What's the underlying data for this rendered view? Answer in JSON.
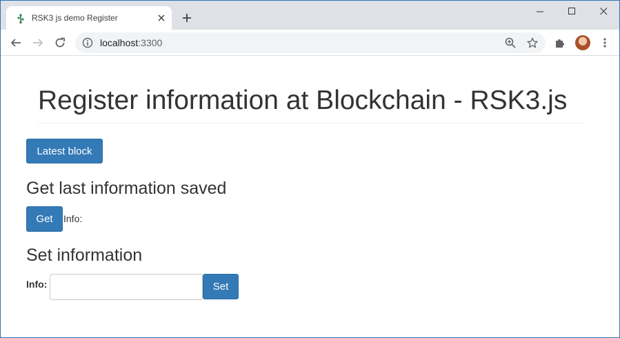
{
  "browser": {
    "tab_title": "RSK3 js demo Register",
    "url_host": "localhost",
    "url_port": ":3300"
  },
  "page": {
    "title": "Register information at Blockchain - RSK3.js",
    "latest_block_button": "Latest block",
    "get_section_heading": "Get last information saved",
    "get_button": "Get",
    "get_info_label": "Info:",
    "set_section_heading": "Set information",
    "set_info_label": "Info:",
    "set_input_value": "",
    "set_button": "Set"
  },
  "colors": {
    "primary_button": "#337ab7",
    "tabstrip": "#dee1e6",
    "text": "#333333"
  }
}
